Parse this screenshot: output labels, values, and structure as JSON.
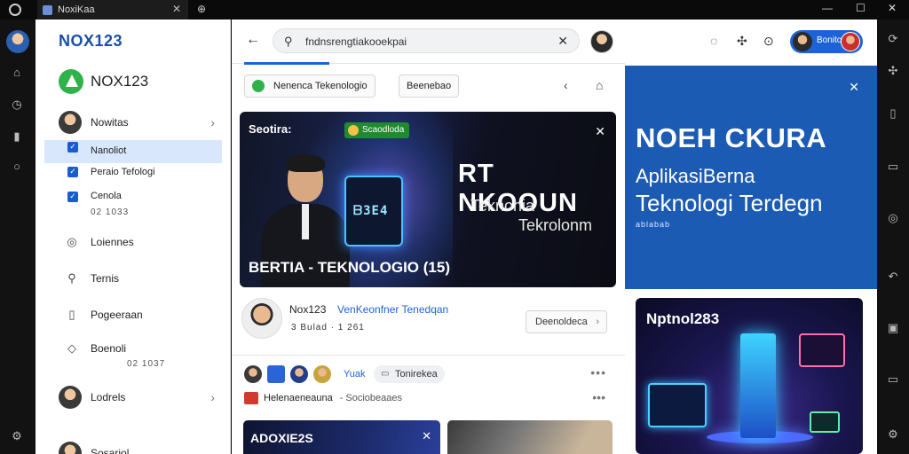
{
  "titlebar": {
    "tab_title": "NoxiKaa",
    "tab_close": "✕",
    "new_tab": "⊕",
    "minimize": "—",
    "maximize": "☐",
    "close": "✕"
  },
  "sidebar": {
    "brand": "NOX123",
    "app_name": "NOX123",
    "items": [
      {
        "label": "Nowitas",
        "chevron": "›"
      },
      {
        "label": "Nanoliot",
        "sub": "Peraio Tefologi",
        "selected": true
      },
      {
        "label": "Cenola",
        "meta": "02 1033"
      },
      {
        "label": "Loiennes",
        "icon": "lightbulb-icon"
      },
      {
        "label": "Ternis",
        "icon": "search-icon"
      },
      {
        "label": "Pogeeraan",
        "icon": "document-icon"
      },
      {
        "label": "Boenoli",
        "meta": "02 1037",
        "icon": "bell-icon"
      },
      {
        "label": "Lodrels",
        "chevron": "›"
      },
      {
        "label": "Sosariol"
      }
    ]
  },
  "main": {
    "back": "←",
    "search_icon": "⚲",
    "search_value": "fndnsrengtiakooekpai",
    "search_clear": "✕",
    "chips": [
      "Nenenca Tekenologio",
      "Beenebao"
    ],
    "share_icon": "‹",
    "home_icon": "⌂",
    "hero": {
      "tag": "Seotira:",
      "badge": "Scaodloda",
      "title": "RT NKOOUN",
      "sub1": "Teknohia",
      "sub2": "Tekrolonm",
      "device_text": "ᗷЗЕ4",
      "caption": "BERTIA - TEKNOLOGIO (15)",
      "close": "✕"
    },
    "post": {
      "name": "Nox123",
      "link": "VenKeonfner Tenedqan",
      "meta": "3  Bulad  ·  1 261",
      "button": "Deenoldeca",
      "button_chevron": "›"
    },
    "feed": {
      "tag": "Yuak",
      "chip": "Tonirekea",
      "dots": "•••",
      "title": "Helenaeneauna",
      "meta": "-  Sociobeaaes",
      "dots2": "•••",
      "thumb_title": "ADOXIE2S",
      "thumb_close": "✕"
    }
  },
  "rpanel": {
    "user_name": "Bonito",
    "ad": {
      "close": "✕",
      "title": "NOEH CKURA",
      "sub1": "AplikasiBerna",
      "sub2": "Teknologi Terdegn",
      "sub3": "ablabab"
    },
    "card_title": "Nptnol283"
  },
  "colors": {
    "accent": "#1e63d6",
    "brand": "#1a4fa8",
    "ad_bg": "#1c5bb3",
    "selected_bg": "#d8e7fb"
  }
}
